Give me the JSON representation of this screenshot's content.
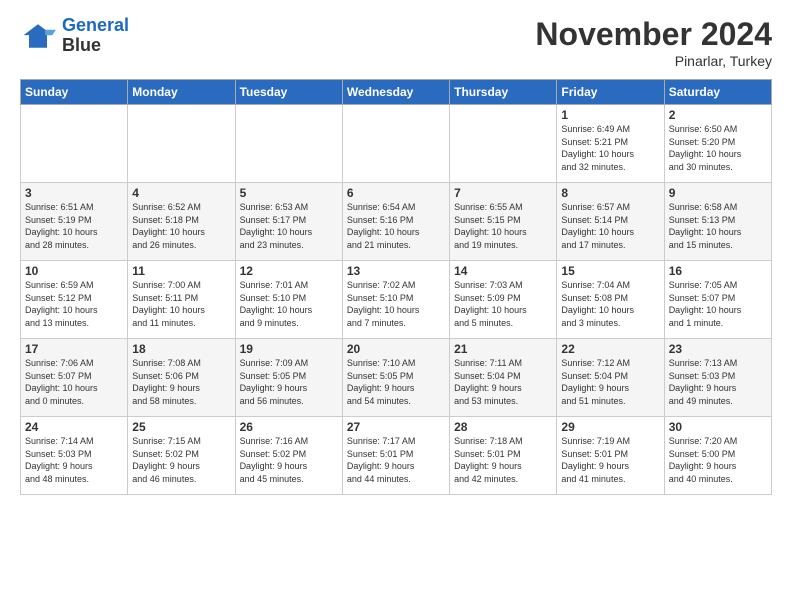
{
  "header": {
    "logo_line1": "General",
    "logo_line2": "Blue",
    "month": "November 2024",
    "location": "Pinarlar, Turkey"
  },
  "weekdays": [
    "Sunday",
    "Monday",
    "Tuesday",
    "Wednesday",
    "Thursday",
    "Friday",
    "Saturday"
  ],
  "weeks": [
    [
      {
        "day": "",
        "info": ""
      },
      {
        "day": "",
        "info": ""
      },
      {
        "day": "",
        "info": ""
      },
      {
        "day": "",
        "info": ""
      },
      {
        "day": "",
        "info": ""
      },
      {
        "day": "1",
        "info": "Sunrise: 6:49 AM\nSunset: 5:21 PM\nDaylight: 10 hours\nand 32 minutes."
      },
      {
        "day": "2",
        "info": "Sunrise: 6:50 AM\nSunset: 5:20 PM\nDaylight: 10 hours\nand 30 minutes."
      }
    ],
    [
      {
        "day": "3",
        "info": "Sunrise: 6:51 AM\nSunset: 5:19 PM\nDaylight: 10 hours\nand 28 minutes."
      },
      {
        "day": "4",
        "info": "Sunrise: 6:52 AM\nSunset: 5:18 PM\nDaylight: 10 hours\nand 26 minutes."
      },
      {
        "day": "5",
        "info": "Sunrise: 6:53 AM\nSunset: 5:17 PM\nDaylight: 10 hours\nand 23 minutes."
      },
      {
        "day": "6",
        "info": "Sunrise: 6:54 AM\nSunset: 5:16 PM\nDaylight: 10 hours\nand 21 minutes."
      },
      {
        "day": "7",
        "info": "Sunrise: 6:55 AM\nSunset: 5:15 PM\nDaylight: 10 hours\nand 19 minutes."
      },
      {
        "day": "8",
        "info": "Sunrise: 6:57 AM\nSunset: 5:14 PM\nDaylight: 10 hours\nand 17 minutes."
      },
      {
        "day": "9",
        "info": "Sunrise: 6:58 AM\nSunset: 5:13 PM\nDaylight: 10 hours\nand 15 minutes."
      }
    ],
    [
      {
        "day": "10",
        "info": "Sunrise: 6:59 AM\nSunset: 5:12 PM\nDaylight: 10 hours\nand 13 minutes."
      },
      {
        "day": "11",
        "info": "Sunrise: 7:00 AM\nSunset: 5:11 PM\nDaylight: 10 hours\nand 11 minutes."
      },
      {
        "day": "12",
        "info": "Sunrise: 7:01 AM\nSunset: 5:10 PM\nDaylight: 10 hours\nand 9 minutes."
      },
      {
        "day": "13",
        "info": "Sunrise: 7:02 AM\nSunset: 5:10 PM\nDaylight: 10 hours\nand 7 minutes."
      },
      {
        "day": "14",
        "info": "Sunrise: 7:03 AM\nSunset: 5:09 PM\nDaylight: 10 hours\nand 5 minutes."
      },
      {
        "day": "15",
        "info": "Sunrise: 7:04 AM\nSunset: 5:08 PM\nDaylight: 10 hours\nand 3 minutes."
      },
      {
        "day": "16",
        "info": "Sunrise: 7:05 AM\nSunset: 5:07 PM\nDaylight: 10 hours\nand 1 minute."
      }
    ],
    [
      {
        "day": "17",
        "info": "Sunrise: 7:06 AM\nSunset: 5:07 PM\nDaylight: 10 hours\nand 0 minutes."
      },
      {
        "day": "18",
        "info": "Sunrise: 7:08 AM\nSunset: 5:06 PM\nDaylight: 9 hours\nand 58 minutes."
      },
      {
        "day": "19",
        "info": "Sunrise: 7:09 AM\nSunset: 5:05 PM\nDaylight: 9 hours\nand 56 minutes."
      },
      {
        "day": "20",
        "info": "Sunrise: 7:10 AM\nSunset: 5:05 PM\nDaylight: 9 hours\nand 54 minutes."
      },
      {
        "day": "21",
        "info": "Sunrise: 7:11 AM\nSunset: 5:04 PM\nDaylight: 9 hours\nand 53 minutes."
      },
      {
        "day": "22",
        "info": "Sunrise: 7:12 AM\nSunset: 5:04 PM\nDaylight: 9 hours\nand 51 minutes."
      },
      {
        "day": "23",
        "info": "Sunrise: 7:13 AM\nSunset: 5:03 PM\nDaylight: 9 hours\nand 49 minutes."
      }
    ],
    [
      {
        "day": "24",
        "info": "Sunrise: 7:14 AM\nSunset: 5:03 PM\nDaylight: 9 hours\nand 48 minutes."
      },
      {
        "day": "25",
        "info": "Sunrise: 7:15 AM\nSunset: 5:02 PM\nDaylight: 9 hours\nand 46 minutes."
      },
      {
        "day": "26",
        "info": "Sunrise: 7:16 AM\nSunset: 5:02 PM\nDaylight: 9 hours\nand 45 minutes."
      },
      {
        "day": "27",
        "info": "Sunrise: 7:17 AM\nSunset: 5:01 PM\nDaylight: 9 hours\nand 44 minutes."
      },
      {
        "day": "28",
        "info": "Sunrise: 7:18 AM\nSunset: 5:01 PM\nDaylight: 9 hours\nand 42 minutes."
      },
      {
        "day": "29",
        "info": "Sunrise: 7:19 AM\nSunset: 5:01 PM\nDaylight: 9 hours\nand 41 minutes."
      },
      {
        "day": "30",
        "info": "Sunrise: 7:20 AM\nSunset: 5:00 PM\nDaylight: 9 hours\nand 40 minutes."
      }
    ]
  ]
}
